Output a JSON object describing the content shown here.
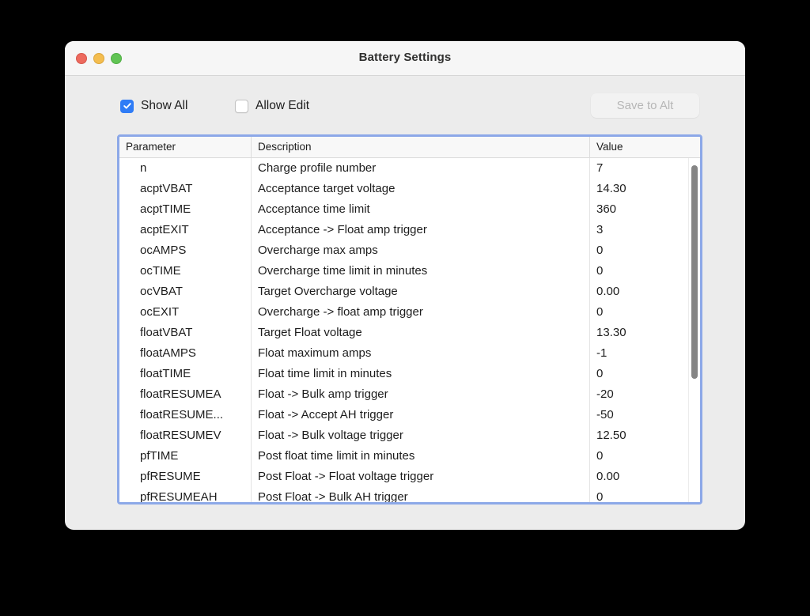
{
  "window": {
    "title": "Battery Settings",
    "traffic_lights": [
      {
        "name": "close-button",
        "color": "#ed6a5e"
      },
      {
        "name": "minimize-button",
        "color": "#f4bd4f"
      },
      {
        "name": "maximize-button",
        "color": "#61c454"
      }
    ]
  },
  "toolbar": {
    "show_all_label": "Show All",
    "show_all_checked": true,
    "allow_edit_label": "Allow Edit",
    "allow_edit_checked": false,
    "save_label": "Save to Alt",
    "save_disabled": true
  },
  "table": {
    "columns": [
      "Parameter",
      "Description",
      "Value"
    ],
    "focus_ring_color": "#8ca8e8",
    "rows": [
      {
        "parameter": "n",
        "description": "Charge profile number",
        "value": "7"
      },
      {
        "parameter": "acptVBAT",
        "description": "Acceptance target voltage",
        "value": "14.30"
      },
      {
        "parameter": "acptTIME",
        "description": "Acceptance time limit",
        "value": "360"
      },
      {
        "parameter": "acptEXIT",
        "description": "Acceptance -> Float amp trigger",
        "value": "3"
      },
      {
        "parameter": "ocAMPS",
        "description": "Overcharge max amps",
        "value": "0"
      },
      {
        "parameter": "ocTIME",
        "description": "Overcharge time limit in minutes",
        "value": "0"
      },
      {
        "parameter": "ocVBAT",
        "description": "Target Overcharge voltage",
        "value": "0.00"
      },
      {
        "parameter": "ocEXIT",
        "description": "Overcharge -> float amp trigger",
        "value": "0"
      },
      {
        "parameter": "floatVBAT",
        "description": "Target Float voltage",
        "value": "13.30"
      },
      {
        "parameter": "floatAMPS",
        "description": "Float maximum amps",
        "value": "-1"
      },
      {
        "parameter": "floatTIME",
        "description": "Float time limit in minutes",
        "value": "0"
      },
      {
        "parameter": "floatRESUMEA",
        "description": "Float -> Bulk amp trigger",
        "value": "-20"
      },
      {
        "parameter": "floatRESUME...",
        "description": "Float -> Accept AH trigger",
        "value": "-50"
      },
      {
        "parameter": "floatRESUMEV",
        "description": "Float -> Bulk voltage trigger",
        "value": "12.50"
      },
      {
        "parameter": "pfTIME",
        "description": "Post float time limit in minutes",
        "value": "0"
      },
      {
        "parameter": "pfRESUME",
        "description": "Post Float -> Float voltage trigger",
        "value": "0.00"
      },
      {
        "parameter": "pfRESUMEAH",
        "description": "Post Float -> Bulk AH trigger",
        "value": "0"
      }
    ],
    "scrollbar": {
      "thumb_top_pct": 1,
      "thumb_height_pct": 62
    }
  }
}
